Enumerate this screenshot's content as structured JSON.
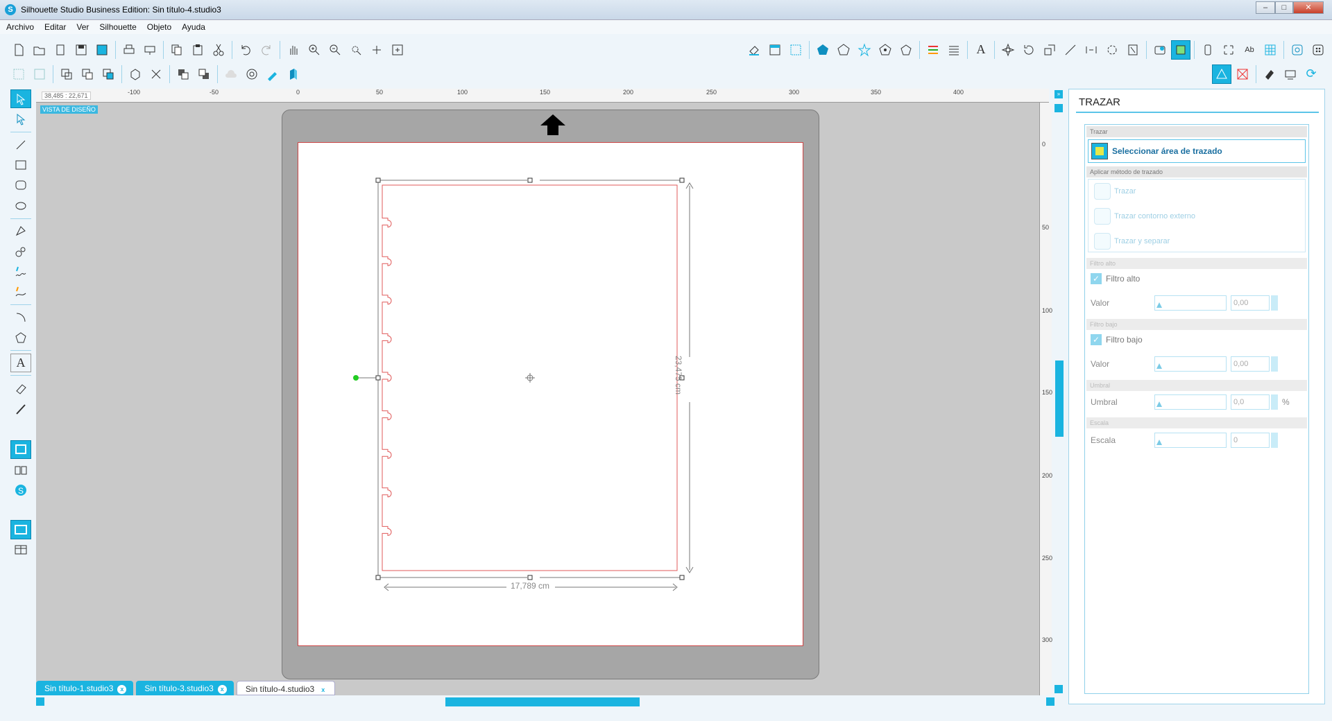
{
  "window": {
    "title": "Silhouette Studio Business Edition: Sin título-4.studio3",
    "controls": {
      "minimize": "–",
      "maximize": "□",
      "close": "✕"
    }
  },
  "menu": [
    "Archivo",
    "Editar",
    "Ver",
    "Silhouette",
    "Objeto",
    "Ayuda"
  ],
  "toolbar": {
    "row1_left_icons": [
      "new-document-icon",
      "open-icon",
      "open-library-icon",
      "save-icon",
      "save-to-library-icon",
      "print-icon",
      "send-to-cutter-icon",
      "copy-icon",
      "paste-icon",
      "cut-icon",
      "undo-icon",
      "redo-icon",
      "pan-icon",
      "zoom-in-icon",
      "zoom-out-icon",
      "zoom-selection-icon",
      "zoom-drag-icon",
      "fit-to-page-icon"
    ],
    "row1_right_icons": [
      "fill-color-icon",
      "page-setup-icon",
      "grid-icon",
      "shape-pentagon-icon",
      "shape-outline-icon",
      "star-icon",
      "shape-2-icon",
      "shape-3-icon",
      "line-color-icon",
      "line-style-icon",
      "text-style-icon",
      "replicate-icon",
      "transform-icon",
      "scale-icon",
      "modify-icon",
      "offset-icon",
      "knife-icon",
      "align-icon",
      "library-icon",
      "trace-icon",
      "send-icon",
      "cut-settings-icon",
      "font-icon",
      "grid-2-icon",
      "spiral-icon",
      "dots-icon",
      "settings-gear-icon"
    ],
    "row2_left_icons": [
      "group-icon",
      "ungroup-icon",
      "compound-icon",
      "release-compound-icon",
      "bring-front-icon",
      "weld-icon",
      "delete-icon",
      "send-back-icon",
      "bring-forward-icon",
      "cloud-icon",
      "target-icon",
      "brush-icon",
      "fill-3d-icon"
    ],
    "row2_right_icons": [
      "sketch-mode-icon",
      "no-cut-icon",
      "eraser-icon",
      "send-to-icon",
      "refresh-icon"
    ]
  },
  "left_tools": [
    "select-pointer-icon",
    "point-edit-icon",
    "line-icon",
    "rectangle-icon",
    "rounded-rectangle-icon",
    "ellipse-icon",
    "polygon-icon",
    "curve-icon",
    "freehand-icon",
    "smooth-freehand-icon",
    "arc-icon",
    "regular-polygon-icon",
    "text-icon",
    "eraser-icon",
    "knife-icon",
    "design-view-icon",
    "library-view-icon",
    "store-icon",
    "single-panel-icon",
    "split-panel-icon"
  ],
  "ruler": {
    "coords": "38,485 : 22,671",
    "h_ticks": [
      "-100",
      "-50",
      "0",
      "50",
      "100",
      "150",
      "200",
      "250",
      "300",
      "350",
      "400"
    ],
    "v_ticks": [
      "0",
      "50",
      "100",
      "150",
      "200",
      "250",
      "300"
    ]
  },
  "canvas": {
    "view_label": "VISTA DE DISEÑO",
    "width_label": "17,789 cm",
    "height_label": "23,475 cm",
    "notch_count": 9
  },
  "tabs": [
    {
      "label": "Sin título-1.studio3",
      "active": false
    },
    {
      "label": "Sin título-3.studio3",
      "active": false
    },
    {
      "label": "Sin título-4.studio3",
      "active": true
    }
  ],
  "panel": {
    "title": "TRAZAR",
    "trace_section": "Trazar",
    "select_area_label": "Seleccionar área de trazado",
    "method_section": "Aplicar método de trazado",
    "methods": [
      "Trazar",
      "Trazar contorno externo",
      "Trazar y separar"
    ],
    "high_filter_section": "Filtro alto",
    "high_filter_check": "Filtro alto",
    "high_value_label": "Valor",
    "high_value": "0,00",
    "low_filter_section": "Filtro bajo",
    "low_filter_check": "Filtro bajo",
    "low_value_label": "Valor",
    "low_value": "0,00",
    "threshold_section": "Umbral",
    "threshold_label": "Umbral",
    "threshold_value": "0,0",
    "threshold_unit": "%",
    "scale_section": "Escala",
    "scale_label": "Escala",
    "scale_value": "0"
  },
  "colors": {
    "accent": "#1ab4e0",
    "cut_line": "#e05a5a",
    "mat": "#a6a6a6"
  }
}
